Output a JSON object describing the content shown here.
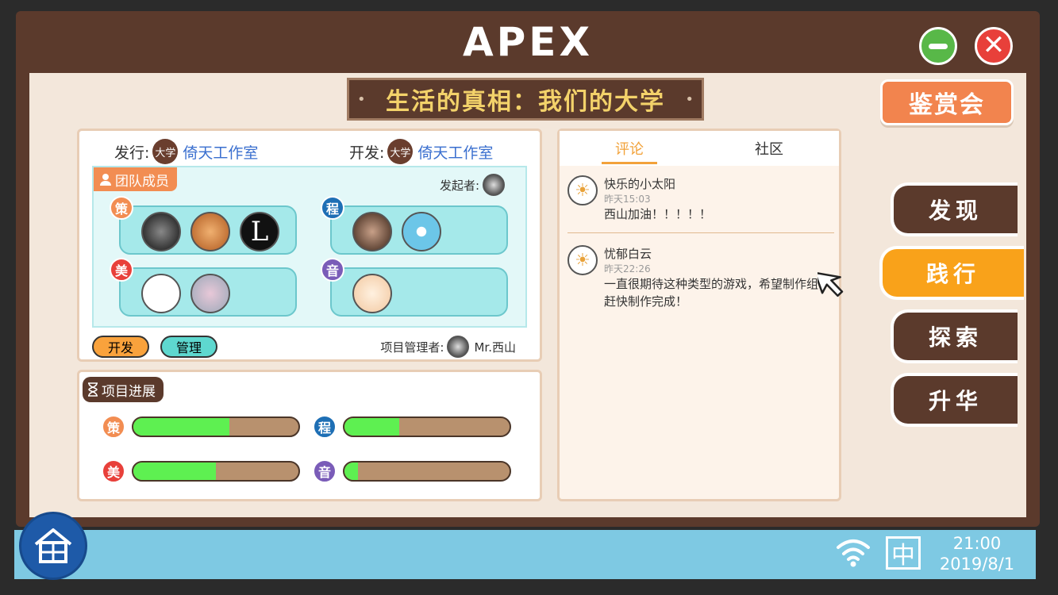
{
  "window": {
    "title": "APEX"
  },
  "banner": {
    "title": "生活的真相：我们的大学"
  },
  "appreciation_button": "鉴赏会",
  "credits": {
    "publisher_label": "发行:",
    "publisher_logo": "大学",
    "publisher_name": "倚天工作室",
    "developer_label": "开发:",
    "developer_logo": "大学",
    "developer_name": "倚天工作室"
  },
  "team": {
    "tag": "团队成员",
    "initiator_label": "发起者:",
    "roles": [
      {
        "badge": "策",
        "color": "#f28d52",
        "members": 3
      },
      {
        "badge": "程",
        "color": "#1e6fb5",
        "members": 2
      },
      {
        "badge": "美",
        "color": "#e8403a",
        "members": 2
      },
      {
        "badge": "音",
        "color": "#7a5cb8",
        "members": 1
      }
    ],
    "dev_button": "开发",
    "mgmt_button": "管理",
    "manager_label": "项目管理者:",
    "manager_name": "Mr.西山"
  },
  "progress": {
    "tag": "项目进展",
    "items": [
      {
        "badge": "策",
        "color": "#f28d52",
        "fraction": 0.58
      },
      {
        "badge": "程",
        "color": "#1e6fb5",
        "fraction": 0.33
      },
      {
        "badge": "美",
        "color": "#e8403a",
        "fraction": 0.5
      },
      {
        "badge": "音",
        "color": "#7a5cb8",
        "fraction": 0.08
      }
    ]
  },
  "comments_panel": {
    "tabs": [
      "评论",
      "社区"
    ],
    "active_tab": 0,
    "comments": [
      {
        "name": "快乐的小太阳",
        "time": "昨天15:03",
        "text": "西山加油！！！！！"
      },
      {
        "name": "忧郁白云",
        "time": "昨天22:26",
        "text": "一直很期待这种类型的游戏，希望制作组赶快制作完成！"
      }
    ]
  },
  "side_nav": [
    "发现",
    "践行",
    "探索",
    "升华"
  ],
  "side_nav_active": 1,
  "taskbar": {
    "ime": "中",
    "time": "21:00",
    "date": "2019/8/1"
  },
  "icons": [
    "minimize-icon",
    "close-icon",
    "home-icon",
    "wifi-icon",
    "cursor-icon",
    "person-icon",
    "hourglass-icon"
  ]
}
